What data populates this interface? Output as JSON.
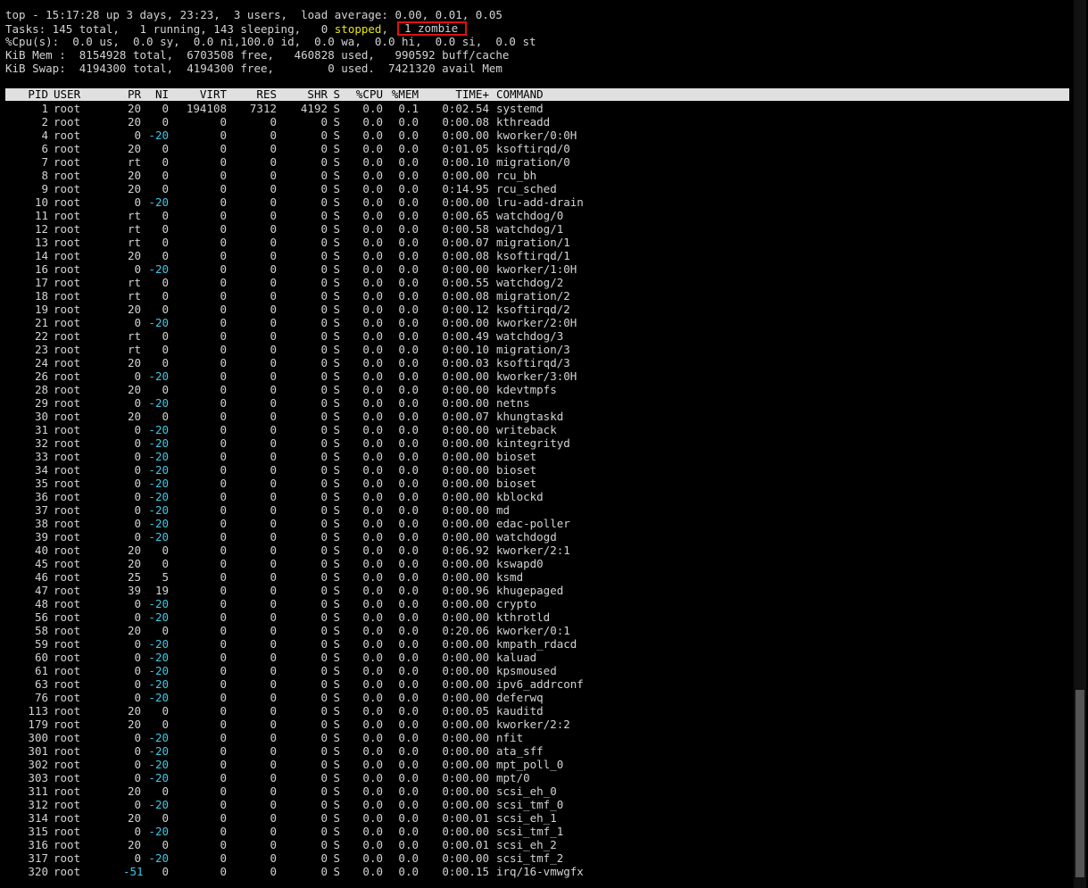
{
  "summary": {
    "line1": "top - 15:17:28 up 3 days, 23:23,  3 users,  load average: 0.00, 0.01, 0.05",
    "tasks_prefix": "Tasks: 145 total,   1 running, 143 sleeping,   0 ",
    "tasks_stopped": "stopped",
    "tasks_sep": ",",
    "tasks_zombie": "1 zombie",
    "cpu": "%Cpu(s):  0.0 us,  0.0 sy,  0.0 ni,100.0 id,  0.0 wa,  0.0 hi,  0.0 si,  0.0 st",
    "mem": "KiB Mem :  8154928 total,  6703508 free,   460828 used,   990592 buff/cache",
    "swap": "KiB Swap:  4194300 total,  4194300 free,        0 used.  7421320 avail Mem"
  },
  "columns": {
    "pid": "PID",
    "user": "USER",
    "pr": "PR",
    "ni": "NI",
    "virt": "VIRT",
    "res": "RES",
    "shr": "SHR",
    "s": "S",
    "cpu": "%CPU",
    "mem": "%MEM",
    "time": "TIME+",
    "command": "COMMAND"
  },
  "processes": [
    [
      "1",
      "root",
      "20",
      "0",
      "194108",
      "7312",
      "4192",
      "S",
      "0.0",
      "0.1",
      "0:02.54",
      "systemd"
    ],
    [
      "2",
      "root",
      "20",
      "0",
      "0",
      "0",
      "0",
      "S",
      "0.0",
      "0.0",
      "0:00.08",
      "kthreadd"
    ],
    [
      "4",
      "root",
      "0",
      "-20",
      "0",
      "0",
      "0",
      "S",
      "0.0",
      "0.0",
      "0:00.00",
      "kworker/0:0H"
    ],
    [
      "6",
      "root",
      "20",
      "0",
      "0",
      "0",
      "0",
      "S",
      "0.0",
      "0.0",
      "0:01.05",
      "ksoftirqd/0"
    ],
    [
      "7",
      "root",
      "rt",
      "0",
      "0",
      "0",
      "0",
      "S",
      "0.0",
      "0.0",
      "0:00.10",
      "migration/0"
    ],
    [
      "8",
      "root",
      "20",
      "0",
      "0",
      "0",
      "0",
      "S",
      "0.0",
      "0.0",
      "0:00.00",
      "rcu_bh"
    ],
    [
      "9",
      "root",
      "20",
      "0",
      "0",
      "0",
      "0",
      "S",
      "0.0",
      "0.0",
      "0:14.95",
      "rcu_sched"
    ],
    [
      "10",
      "root",
      "0",
      "-20",
      "0",
      "0",
      "0",
      "S",
      "0.0",
      "0.0",
      "0:00.00",
      "lru-add-drain"
    ],
    [
      "11",
      "root",
      "rt",
      "0",
      "0",
      "0",
      "0",
      "S",
      "0.0",
      "0.0",
      "0:00.65",
      "watchdog/0"
    ],
    [
      "12",
      "root",
      "rt",
      "0",
      "0",
      "0",
      "0",
      "S",
      "0.0",
      "0.0",
      "0:00.58",
      "watchdog/1"
    ],
    [
      "13",
      "root",
      "rt",
      "0",
      "0",
      "0",
      "0",
      "S",
      "0.0",
      "0.0",
      "0:00.07",
      "migration/1"
    ],
    [
      "14",
      "root",
      "20",
      "0",
      "0",
      "0",
      "0",
      "S",
      "0.0",
      "0.0",
      "0:00.08",
      "ksoftirqd/1"
    ],
    [
      "16",
      "root",
      "0",
      "-20",
      "0",
      "0",
      "0",
      "S",
      "0.0",
      "0.0",
      "0:00.00",
      "kworker/1:0H"
    ],
    [
      "17",
      "root",
      "rt",
      "0",
      "0",
      "0",
      "0",
      "S",
      "0.0",
      "0.0",
      "0:00.55",
      "watchdog/2"
    ],
    [
      "18",
      "root",
      "rt",
      "0",
      "0",
      "0",
      "0",
      "S",
      "0.0",
      "0.0",
      "0:00.08",
      "migration/2"
    ],
    [
      "19",
      "root",
      "20",
      "0",
      "0",
      "0",
      "0",
      "S",
      "0.0",
      "0.0",
      "0:00.12",
      "ksoftirqd/2"
    ],
    [
      "21",
      "root",
      "0",
      "-20",
      "0",
      "0",
      "0",
      "S",
      "0.0",
      "0.0",
      "0:00.00",
      "kworker/2:0H"
    ],
    [
      "22",
      "root",
      "rt",
      "0",
      "0",
      "0",
      "0",
      "S",
      "0.0",
      "0.0",
      "0:00.49",
      "watchdog/3"
    ],
    [
      "23",
      "root",
      "rt",
      "0",
      "0",
      "0",
      "0",
      "S",
      "0.0",
      "0.0",
      "0:00.10",
      "migration/3"
    ],
    [
      "24",
      "root",
      "20",
      "0",
      "0",
      "0",
      "0",
      "S",
      "0.0",
      "0.0",
      "0:00.03",
      "ksoftirqd/3"
    ],
    [
      "26",
      "root",
      "0",
      "-20",
      "0",
      "0",
      "0",
      "S",
      "0.0",
      "0.0",
      "0:00.00",
      "kworker/3:0H"
    ],
    [
      "28",
      "root",
      "20",
      "0",
      "0",
      "0",
      "0",
      "S",
      "0.0",
      "0.0",
      "0:00.00",
      "kdevtmpfs"
    ],
    [
      "29",
      "root",
      "0",
      "-20",
      "0",
      "0",
      "0",
      "S",
      "0.0",
      "0.0",
      "0:00.00",
      "netns"
    ],
    [
      "30",
      "root",
      "20",
      "0",
      "0",
      "0",
      "0",
      "S",
      "0.0",
      "0.0",
      "0:00.07",
      "khungtaskd"
    ],
    [
      "31",
      "root",
      "0",
      "-20",
      "0",
      "0",
      "0",
      "S",
      "0.0",
      "0.0",
      "0:00.00",
      "writeback"
    ],
    [
      "32",
      "root",
      "0",
      "-20",
      "0",
      "0",
      "0",
      "S",
      "0.0",
      "0.0",
      "0:00.00",
      "kintegrityd"
    ],
    [
      "33",
      "root",
      "0",
      "-20",
      "0",
      "0",
      "0",
      "S",
      "0.0",
      "0.0",
      "0:00.00",
      "bioset"
    ],
    [
      "34",
      "root",
      "0",
      "-20",
      "0",
      "0",
      "0",
      "S",
      "0.0",
      "0.0",
      "0:00.00",
      "bioset"
    ],
    [
      "35",
      "root",
      "0",
      "-20",
      "0",
      "0",
      "0",
      "S",
      "0.0",
      "0.0",
      "0:00.00",
      "bioset"
    ],
    [
      "36",
      "root",
      "0",
      "-20",
      "0",
      "0",
      "0",
      "S",
      "0.0",
      "0.0",
      "0:00.00",
      "kblockd"
    ],
    [
      "37",
      "root",
      "0",
      "-20",
      "0",
      "0",
      "0",
      "S",
      "0.0",
      "0.0",
      "0:00.00",
      "md"
    ],
    [
      "38",
      "root",
      "0",
      "-20",
      "0",
      "0",
      "0",
      "S",
      "0.0",
      "0.0",
      "0:00.00",
      "edac-poller"
    ],
    [
      "39",
      "root",
      "0",
      "-20",
      "0",
      "0",
      "0",
      "S",
      "0.0",
      "0.0",
      "0:00.00",
      "watchdogd"
    ],
    [
      "40",
      "root",
      "20",
      "0",
      "0",
      "0",
      "0",
      "S",
      "0.0",
      "0.0",
      "0:06.92",
      "kworker/2:1"
    ],
    [
      "45",
      "root",
      "20",
      "0",
      "0",
      "0",
      "0",
      "S",
      "0.0",
      "0.0",
      "0:00.00",
      "kswapd0"
    ],
    [
      "46",
      "root",
      "25",
      "5",
      "0",
      "0",
      "0",
      "S",
      "0.0",
      "0.0",
      "0:00.00",
      "ksmd"
    ],
    [
      "47",
      "root",
      "39",
      "19",
      "0",
      "0",
      "0",
      "S",
      "0.0",
      "0.0",
      "0:00.96",
      "khugepaged"
    ],
    [
      "48",
      "root",
      "0",
      "-20",
      "0",
      "0",
      "0",
      "S",
      "0.0",
      "0.0",
      "0:00.00",
      "crypto"
    ],
    [
      "56",
      "root",
      "0",
      "-20",
      "0",
      "0",
      "0",
      "S",
      "0.0",
      "0.0",
      "0:00.00",
      "kthrotld"
    ],
    [
      "58",
      "root",
      "20",
      "0",
      "0",
      "0",
      "0",
      "S",
      "0.0",
      "0.0",
      "0:20.06",
      "kworker/0:1"
    ],
    [
      "59",
      "root",
      "0",
      "-20",
      "0",
      "0",
      "0",
      "S",
      "0.0",
      "0.0",
      "0:00.00",
      "kmpath_rdacd"
    ],
    [
      "60",
      "root",
      "0",
      "-20",
      "0",
      "0",
      "0",
      "S",
      "0.0",
      "0.0",
      "0:00.00",
      "kaluad"
    ],
    [
      "61",
      "root",
      "0",
      "-20",
      "0",
      "0",
      "0",
      "S",
      "0.0",
      "0.0",
      "0:00.00",
      "kpsmoused"
    ],
    [
      "63",
      "root",
      "0",
      "-20",
      "0",
      "0",
      "0",
      "S",
      "0.0",
      "0.0",
      "0:00.00",
      "ipv6_addrconf"
    ],
    [
      "76",
      "root",
      "0",
      "-20",
      "0",
      "0",
      "0",
      "S",
      "0.0",
      "0.0",
      "0:00.00",
      "deferwq"
    ],
    [
      "113",
      "root",
      "20",
      "0",
      "0",
      "0",
      "0",
      "S",
      "0.0",
      "0.0",
      "0:00.05",
      "kauditd"
    ],
    [
      "179",
      "root",
      "20",
      "0",
      "0",
      "0",
      "0",
      "S",
      "0.0",
      "0.0",
      "0:00.00",
      "kworker/2:2"
    ],
    [
      "300",
      "root",
      "0",
      "-20",
      "0",
      "0",
      "0",
      "S",
      "0.0",
      "0.0",
      "0:00.00",
      "nfit"
    ],
    [
      "301",
      "root",
      "0",
      "-20",
      "0",
      "0",
      "0",
      "S",
      "0.0",
      "0.0",
      "0:00.00",
      "ata_sff"
    ],
    [
      "302",
      "root",
      "0",
      "-20",
      "0",
      "0",
      "0",
      "S",
      "0.0",
      "0.0",
      "0:00.00",
      "mpt_poll_0"
    ],
    [
      "303",
      "root",
      "0",
      "-20",
      "0",
      "0",
      "0",
      "S",
      "0.0",
      "0.0",
      "0:00.00",
      "mpt/0"
    ],
    [
      "311",
      "root",
      "20",
      "0",
      "0",
      "0",
      "0",
      "S",
      "0.0",
      "0.0",
      "0:00.00",
      "scsi_eh_0"
    ],
    [
      "312",
      "root",
      "0",
      "-20",
      "0",
      "0",
      "0",
      "S",
      "0.0",
      "0.0",
      "0:00.00",
      "scsi_tmf_0"
    ],
    [
      "314",
      "root",
      "20",
      "0",
      "0",
      "0",
      "0",
      "S",
      "0.0",
      "0.0",
      "0:00.01",
      "scsi_eh_1"
    ],
    [
      "315",
      "root",
      "0",
      "-20",
      "0",
      "0",
      "0",
      "S",
      "0.0",
      "0.0",
      "0:00.00",
      "scsi_tmf_1"
    ],
    [
      "316",
      "root",
      "20",
      "0",
      "0",
      "0",
      "0",
      "S",
      "0.0",
      "0.0",
      "0:00.01",
      "scsi_eh_2"
    ],
    [
      "317",
      "root",
      "0",
      "-20",
      "0",
      "0",
      "0",
      "S",
      "0.0",
      "0.0",
      "0:00.00",
      "scsi_tmf_2"
    ],
    [
      "320",
      "root",
      "-51",
      "0",
      "0",
      "0",
      "0",
      "S",
      "0.0",
      "0.0",
      "0:00.15",
      "irq/16-vmwgfx"
    ]
  ],
  "colors": {
    "background": "#000000",
    "text": "#d3d3d3",
    "stopped": "#e5e510",
    "highlight_box": "#e01010",
    "nice_negative": "#3ec8e4",
    "header_bg": "#e0e0e0"
  }
}
